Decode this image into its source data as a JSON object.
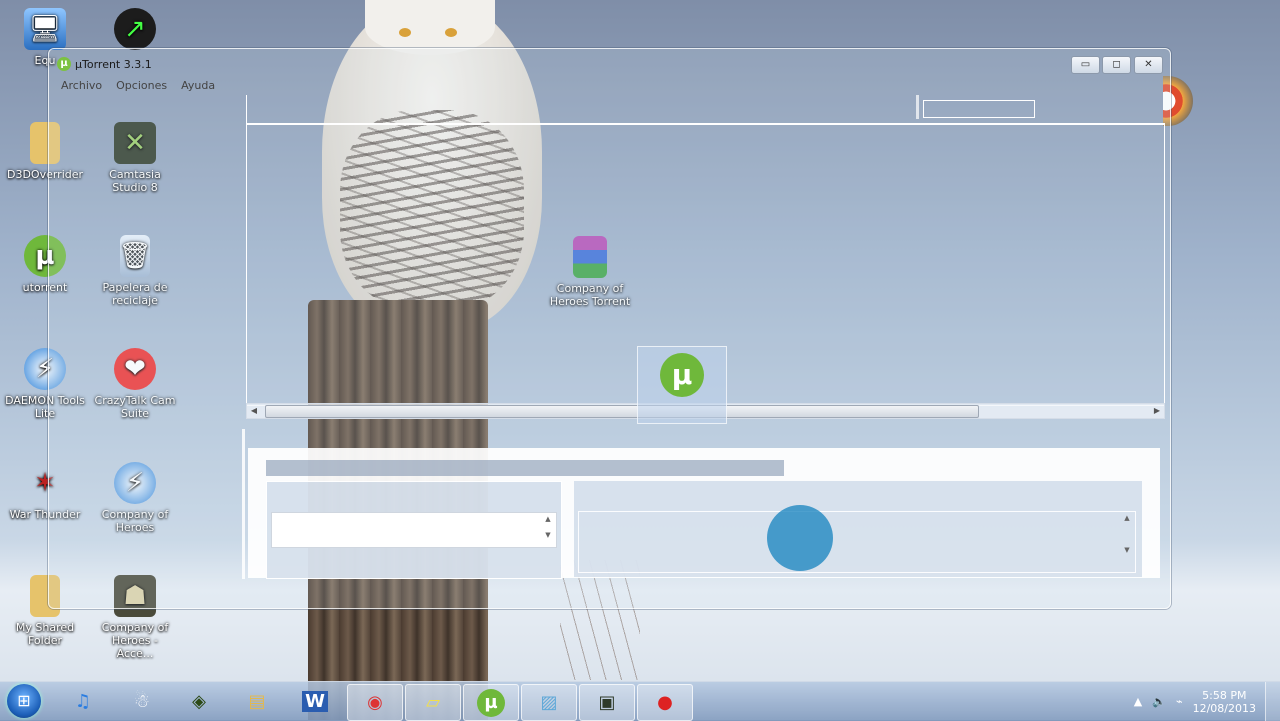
{
  "window": {
    "title": "µTorrent 3.3.1",
    "menus": [
      "Archivo",
      "Opciones",
      "Ayuda"
    ],
    "buttons": {
      "minimize": "▭",
      "maximize": "◻",
      "close": "✕"
    }
  },
  "desktop_icons": [
    {
      "label": "Equ",
      "icon": "computer-icon"
    },
    {
      "label": "",
      "icon": "app-icon"
    },
    {
      "label": "D3DOverrider",
      "icon": "folder-icon"
    },
    {
      "label": "Camtasia Studio 8",
      "icon": "camtasia-icon"
    },
    {
      "label": "utorrent",
      "icon": "utorrent-icon"
    },
    {
      "label": "Papelera de reciclaje",
      "icon": "recycle-bin-icon"
    },
    {
      "label": "DAEMON Tools Lite",
      "icon": "daemon-tools-icon"
    },
    {
      "label": "CrazyTalk Cam Suite",
      "icon": "crazytalk-icon"
    },
    {
      "label": "War Thunder",
      "icon": "war-thunder-icon"
    },
    {
      "label": "Company of Heroes",
      "icon": "company-of-heroes-icon"
    },
    {
      "label": "My Shared Folder",
      "icon": "folder-icon"
    },
    {
      "label": "Company of Heroes - Acce...",
      "icon": "company-of-heroes-icon"
    },
    {
      "label": "Company of Heroes Torrent",
      "icon": "winrar-icon"
    }
  ],
  "dragged_icon": {
    "icon": "utorrent-icon"
  },
  "taskbar": {
    "start_label": "⊞",
    "apps": [
      {
        "name": "itunes",
        "glyph": "♫"
      },
      {
        "name": "pidgin",
        "glyph": "☃"
      },
      {
        "name": "app",
        "glyph": "◈"
      },
      {
        "name": "explorer",
        "glyph": "▤"
      },
      {
        "name": "word",
        "glyph": "W"
      },
      {
        "name": "chrome",
        "glyph": "◉"
      },
      {
        "name": "notes",
        "glyph": "▱"
      },
      {
        "name": "utorrent",
        "glyph": "µ"
      },
      {
        "name": "notepad",
        "glyph": "▨"
      },
      {
        "name": "camtasia",
        "glyph": "▣"
      },
      {
        "name": "recorder",
        "glyph": "●"
      }
    ],
    "time": "5:58 PM",
    "date": "12/08/2013"
  }
}
